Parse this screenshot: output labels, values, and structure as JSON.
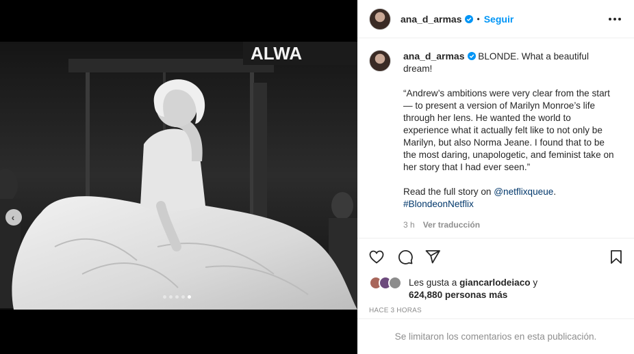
{
  "post": {
    "username": "ana_d_armas",
    "follow_label": "Seguir",
    "separator": "•",
    "caption": {
      "line1": "BLONDE. What a beautiful dream!",
      "quote": "“Andrew’s ambitions were very clear from the start — to present a version of Marilyn Monroe’s life through her lens. He wanted the world to experience what it actually felt like to not only be Marilyn, but also Norma Jeane. I found that to be the most daring, unapologetic, and feminist take on her story that I had ever seen.”",
      "read_more_prefix": "Read the full story on ",
      "mention": "@netflixqueue",
      "suffix": ".",
      "hashtag": "#BlondeonNetflix"
    },
    "caption_time": "3 h",
    "see_translation": "Ver traducción",
    "likes_prefix": "Les gusta a ",
    "likes_user": "giancarlodeiaco",
    "likes_joiner": " y",
    "likes_count_text": "624,880 personas más",
    "timestamp": "HACE 3 HORAS",
    "comments_disabled_text": "Se limitaron los comentarios en esta publicación."
  },
  "media": {
    "sign_text": "ALWA",
    "carousel_total": 5,
    "carousel_active_index": 4
  },
  "colors": {
    "accent": "#0095f6",
    "link": "#00376b",
    "muted": "#8e8e8e",
    "text": "#262626",
    "border": "#efefef"
  },
  "icons": {
    "like": "heart-icon",
    "comment": "comment-icon",
    "share": "paper-plane-icon",
    "save": "bookmark-icon",
    "more": "more-options-icon",
    "verified": "verified-badge-icon",
    "prev": "chevron-left-icon"
  }
}
